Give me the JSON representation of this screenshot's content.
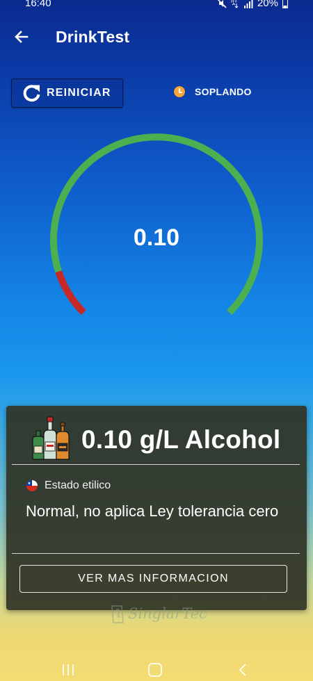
{
  "status_bar": {
    "time": "16:40",
    "battery": "20%",
    "icons": [
      "mute-icon",
      "network-type-icon",
      "signal-icon",
      "battery-icon"
    ]
  },
  "app_bar": {
    "title": "DrinkTest",
    "back_icon": "arrow-left-icon"
  },
  "controls": {
    "reset_label": "REINICIAR",
    "reset_icon": "refresh-icon",
    "status_label": "SOPLANDO",
    "status_icon": "clock-icon"
  },
  "gauge": {
    "value": "0.10",
    "level_fraction": 0.1,
    "colors": {
      "safe": "#4caf50",
      "danger": "#c62828"
    }
  },
  "result": {
    "title": "0.10 g/L Alcohol",
    "icon": "bottles-icon",
    "state_label": "Estado etilico",
    "state_value": "Normal, no aplica Ley tolerancia cero",
    "flag_icon": "chile-flag-icon",
    "info_button": "VER MAS INFORMACION"
  },
  "branding": {
    "logo_text": "SinglarTec"
  },
  "nav_bar": {
    "icons": [
      "recents-icon",
      "home-icon",
      "back-icon"
    ]
  }
}
